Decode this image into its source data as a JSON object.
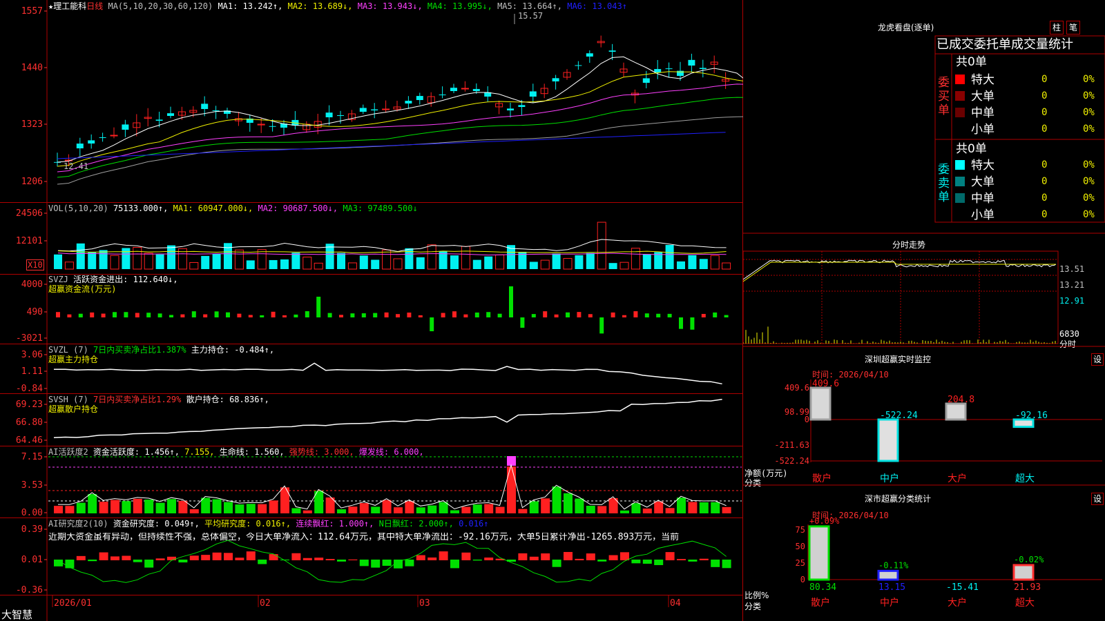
{
  "stock": {
    "name": "理工能科",
    "period": "日线"
  },
  "colors": {
    "up": "#ff2020",
    "down": "#00f0f0",
    "grid": "#b00000",
    "axis": "#ff3030",
    "white": "#ffffff",
    "yellow": "#f0f000",
    "magenta": "#ff40ff",
    "green": "#00e000",
    "gray": "#a0a0a0",
    "blue": "#2020ff"
  },
  "main_panel": {
    "title": "★理工能科",
    "period_label": "日线",
    "ma_params": "MA(5,10,20,30,60,120)",
    "ma_values": [
      {
        "label": "MA1: 13.242↑,",
        "color": "#ffffff"
      },
      {
        "label": "MA2: 13.689↓,",
        "color": "#f0f000"
      },
      {
        "label": "MA3: 13.943↓,",
        "color": "#ff40ff"
      },
      {
        "label": "MA4: 13.995↓,",
        "color": "#00e000"
      },
      {
        "label": "MA5: 13.664↑,",
        "color": "#c0c0c0"
      },
      {
        "label": "MA6: 13.043↑",
        "color": "#2020ff"
      }
    ],
    "y_ticks": [
      "1557",
      "1440",
      "1323",
      "1206"
    ],
    "high_label": "15.57",
    "low_label": "12.41"
  },
  "vol_panel": {
    "title": "VOL(5,10,20)",
    "vol": "75133.000↑,",
    "ma1": "MA1: 60947.000↓,",
    "ma2": "MA2: 90687.500↓,",
    "ma3": "MA3: 97489.500↓",
    "y_ticks": [
      "24506",
      "12101"
    ],
    "unit": "X10"
  },
  "svzj_panel": {
    "title": "SVZJ",
    "line1": "活跃资金进出: 112.640↓,",
    "line2": "超赢资金流(万元)",
    "y_ticks": [
      "4000",
      "490",
      "-3021"
    ]
  },
  "svzl_panel": {
    "title": "SVZL (7)",
    "ratio": "7日内买卖净占比1.387%",
    "hold": "主力持仓: -0.484↑,",
    "sub": "超赢主力持仓",
    "y_ticks": [
      "3.06",
      "1.11",
      "-0.84"
    ]
  },
  "svsh_panel": {
    "title": "SVSH (7)",
    "ratio": "7日内买卖净占比1.29%",
    "hold": "散户持仓: 68.836↑,",
    "sub": "超赢散户持仓",
    "y_ticks": [
      "69.23",
      "66.80",
      "64.46"
    ]
  },
  "ai_active_panel": {
    "title": "AI活跃度2",
    "activity": "资金活跃度: 1.456↑,",
    "v2": "7.155,",
    "life": "生命线: 1.560,",
    "strong": "强势线: 3.000,",
    "burst": "爆发线: 6.000,",
    "y_ticks": [
      "7.15",
      "3.53",
      "0.00"
    ]
  },
  "ai_research_panel": {
    "title": "AI研究度2(10)",
    "research": "资金研究度: 0.049↑,",
    "avg": "平均研究度: 0.016↑,",
    "consec": "连续飘红: 1.000↑,",
    "nday": "N日飘红: 2.000↑,",
    "v5": "0.016↑",
    "comment": "近期大资金虽有异动，但持续性不强，总体偏空，今日大单净流入：112.64万元，其中特大单净流出：-92.16万元，大单5日累计净出-1265.893万元，当前",
    "y_ticks": [
      "0.39",
      "0.01",
      "-0.36"
    ]
  },
  "x_axis": {
    "labels": [
      "2026/01",
      "02",
      "03",
      "04"
    ]
  },
  "brand": "大智慧",
  "right": {
    "dragon_title": "龙虎看盘(逐单)",
    "tab1": "柱",
    "tab2": "笔",
    "orders_header": "已成交委托单成交量统计",
    "buy_label": "委买单",
    "sell_label": "委卖单",
    "buy_total": "共0单",
    "sell_total": "共0单",
    "buy_rows": [
      {
        "name": "特大",
        "val": "0",
        "pct": "0%",
        "color": "#ff0000"
      },
      {
        "name": "大单",
        "val": "0",
        "pct": "0%",
        "color": "#8a0000"
      },
      {
        "name": "中单",
        "val": "0",
        "pct": "0%",
        "color": "#6a0000"
      },
      {
        "name": "小单",
        "val": "0",
        "pct": "0%",
        "color": ""
      }
    ],
    "sell_rows": [
      {
        "name": "特大",
        "val": "0",
        "pct": "0%",
        "color": "#00ffff"
      },
      {
        "name": "大单",
        "val": "0",
        "pct": "0%",
        "color": "#008080"
      },
      {
        "name": "中单",
        "val": "0",
        "pct": "0%",
        "color": "#006a6a"
      },
      {
        "name": "小单",
        "val": "0",
        "pct": "0%",
        "color": ""
      }
    ],
    "intraday_title": "分时走势",
    "intraday_ticks": [
      "13.51",
      "13.21",
      "12.91"
    ],
    "intraday_vol": "6830",
    "intraday_unit": "分时",
    "monitor_title": "深圳超赢实时监控",
    "monitor_time": "时间: 2026/04/10",
    "monitor_set": "设",
    "monitor_ticks": [
      "409.6",
      "98.99",
      "0",
      "-211.63",
      "-522.24"
    ],
    "monitor_unit": "净额(万元)",
    "monitor_cat_label": "分类",
    "monitor_bars": [
      {
        "cat": "散户",
        "value": 409.6,
        "label": "409.6"
      },
      {
        "cat": "中户",
        "value": -522.24,
        "label": "-522.24"
      },
      {
        "cat": "大户",
        "value": 204.8,
        "label": "204.8"
      },
      {
        "cat": "超大",
        "value": -92.16,
        "label": "-92.16"
      }
    ],
    "class_title": "深市超赢分类统计",
    "class_time": "时间: 2026/04/10",
    "class_set": "设",
    "class_ticks": [
      "75",
      "50",
      "25",
      "0"
    ],
    "class_unit": "比例%",
    "class_cat_label": "分类",
    "class_bars": [
      {
        "cat": "散户",
        "value": 80.34,
        "top": "+0.09%",
        "bottom": "80.34"
      },
      {
        "cat": "中户",
        "value": 13.15,
        "top": "-0.11%",
        "bottom": "13.15"
      },
      {
        "cat": "大户",
        "value": 0,
        "top": "",
        "bottom": "-15.41"
      },
      {
        "cat": "超大",
        "value": 21.93,
        "top": "-0.02%",
        "bottom": "21.93"
      }
    ]
  },
  "chart_data": {
    "type": "bar",
    "categories": [
      "散户",
      "中户",
      "大户",
      "超大"
    ],
    "series": [
      {
        "name": "净额(万元)",
        "values": [
          409.6,
          -522.24,
          204.8,
          -92.16
        ]
      }
    ],
    "ylim": [
      -522.24,
      409.6
    ]
  }
}
